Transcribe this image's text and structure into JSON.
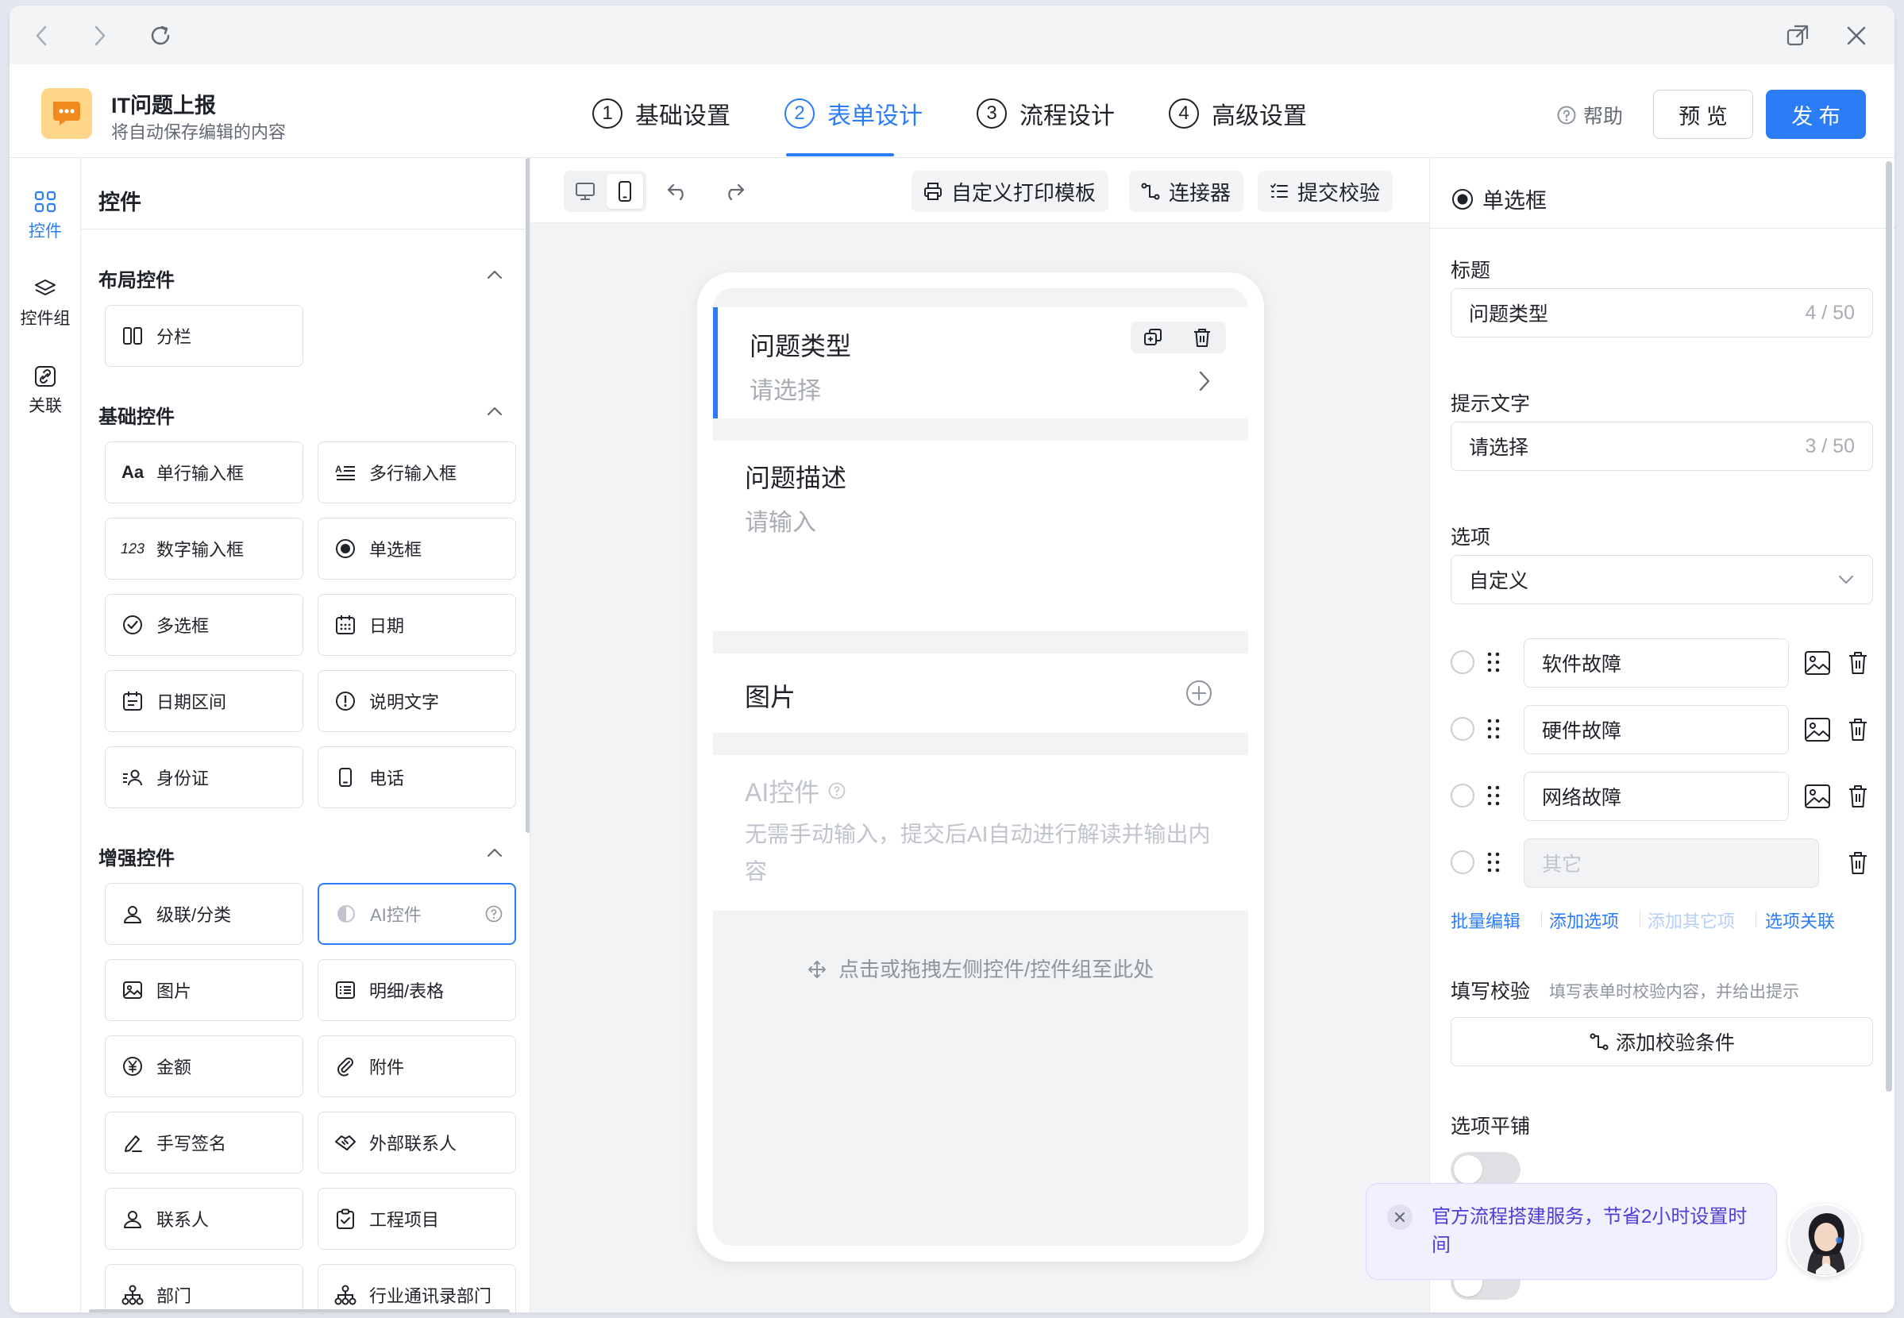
{
  "app": {
    "name": "IT问题上报",
    "subtitle": "将自动保存编辑的内容",
    "help": "帮助",
    "preview": "预 览",
    "publish": "发 布"
  },
  "steps": [
    {
      "num": "1",
      "label": "基础设置"
    },
    {
      "num": "2",
      "label": "表单设计"
    },
    {
      "num": "3",
      "label": "流程设计"
    },
    {
      "num": "4",
      "label": "高级设置"
    }
  ],
  "rail": {
    "controls": "控件",
    "groups": "控件组",
    "relations": "关联"
  },
  "palette": {
    "title": "控件",
    "layout_title": "布局控件",
    "basic_title": "基础控件",
    "enhanced_title": "增强控件",
    "layout": [
      "分栏"
    ],
    "basic": [
      "单行输入框",
      "多行输入框",
      "数字输入框",
      "单选框",
      "多选框",
      "日期",
      "日期区间",
      "说明文字",
      "身份证",
      "电话"
    ],
    "enhanced": [
      "级联/分类",
      "AI控件",
      "图片",
      "明细/表格",
      "金额",
      "附件",
      "手写签名",
      "外部联系人",
      "联系人",
      "工程项目",
      "部门",
      "行业通讯录部门"
    ],
    "icons": {
      "text_aa": "Aa",
      "num_123": "123"
    }
  },
  "canvas": {
    "print_template": "自定义打印模板",
    "connector": "连接器",
    "submit_check": "提交校验",
    "fields": {
      "f1_label": "问题类型",
      "f1_placeholder": "请选择",
      "f2_label": "问题描述",
      "f2_placeholder": "请输入",
      "f3_label": "图片",
      "f4_label": "AI控件",
      "f4_desc": "无需手动输入，提交后AI自动进行解读并输出内容"
    },
    "drop_hint": "点击或拖拽左侧控件/控件组至此处"
  },
  "props": {
    "type": "单选框",
    "title_label": "标题",
    "title_value": "问题类型",
    "title_count": "4 / 50",
    "hint_label": "提示文字",
    "hint_value": "请选择",
    "hint_count": "3 / 50",
    "options_label": "选项",
    "options_mode": "自定义",
    "options": [
      "软件故障",
      "硬件故障",
      "网络故障"
    ],
    "other_placeholder": "其它",
    "links": {
      "batch": "批量编辑",
      "add": "添加选项",
      "add_other": "添加其它项",
      "relate": "选项关联"
    },
    "validate_label": "填写校验",
    "validate_hint": "填写表单时校验内容，并给出提示",
    "add_validate": "添加校验条件",
    "tile_label": "选项平铺"
  },
  "promo": {
    "text": "官方流程搭建服务，节省2小时设置时间"
  },
  "colors": {
    "accent": "#2b7cf7",
    "logo_bg": "#ffd58a",
    "promo_text": "#4b3fd8"
  }
}
